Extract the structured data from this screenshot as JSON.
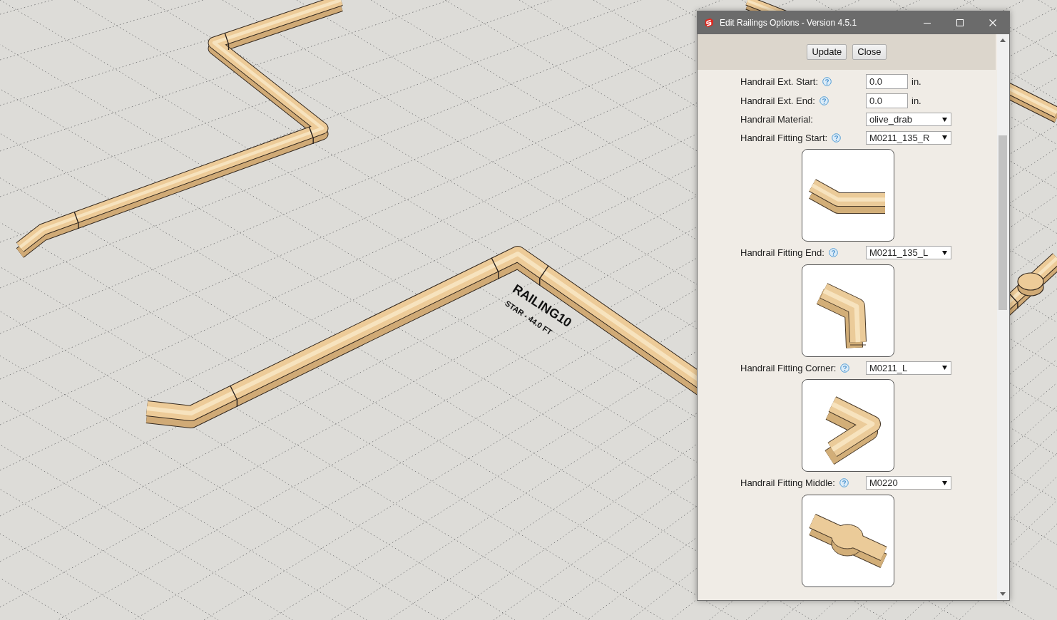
{
  "viewport": {
    "labels": [
      {
        "kind": "name",
        "text": "RAILING10"
      },
      {
        "kind": "dimension",
        "text": "STAR - 44.0 FT"
      }
    ]
  },
  "dialog": {
    "title": "Edit Railings Options - Version 4.5.1",
    "buttons": [
      "Update",
      "Close"
    ],
    "fields": [
      {
        "kind": "number",
        "label": "Handrail Ext. Start:",
        "help": true,
        "value": "0.0",
        "unit": "in."
      },
      {
        "kind": "number",
        "label": "Handrail Ext. End:",
        "help": true,
        "value": "0.0",
        "unit": "in."
      },
      {
        "kind": "select",
        "label": "Handrail Material:",
        "help": false,
        "value": "olive_drab"
      },
      {
        "kind": "fitting",
        "label": "Handrail Fitting Start:",
        "help": true,
        "value": "M0211_135_R"
      },
      {
        "kind": "fitting",
        "label": "Handrail Fitting End:",
        "help": true,
        "value": "M0211_135_L"
      },
      {
        "kind": "fitting",
        "label": "Handrail Fitting Corner:",
        "help": true,
        "value": "M0211_L"
      },
      {
        "kind": "fitting",
        "label": "Handrail Fitting Middle:",
        "help": true,
        "value": "M0220"
      }
    ]
  }
}
